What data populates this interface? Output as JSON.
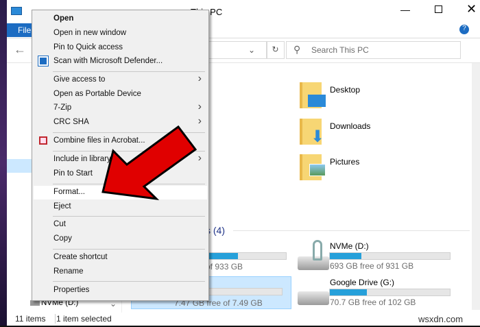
{
  "window": {
    "title": "This PC",
    "file_tab": "File",
    "search_placeholder": "Search This PC"
  },
  "folders": [
    {
      "name": "Desktop"
    },
    {
      "name": "Downloads"
    },
    {
      "name": "Pictures"
    }
  ],
  "devices_header": "s (4)",
  "drives": [
    {
      "name": "",
      "detail": "of 933 GB",
      "used": 0.4
    },
    {
      "name": ":)",
      "detail": "7.47 GB free of 7.49 GB",
      "used": 0.01
    },
    {
      "name": "NVMe (D:)",
      "detail": "693 GB free of 931 GB",
      "used": 0.26
    },
    {
      "name": "Google Drive (G:)",
      "detail": "70.7 GB free of 102 GB",
      "used": 0.31
    }
  ],
  "nav": {
    "last_item": "NVMe (D:)"
  },
  "status": {
    "items": "11 items",
    "selected": "1 item selected"
  },
  "menu": [
    {
      "label": "Open",
      "bold": true
    },
    {
      "label": "Open in new window"
    },
    {
      "label": "Pin to Quick access"
    },
    {
      "label": "Scan with Microsoft Defender..."
    },
    {
      "label": "Give access to",
      "sub": true
    },
    {
      "label": "Open as Portable Device"
    },
    {
      "label": "7-Zip",
      "sub": true
    },
    {
      "label": "CRC SHA",
      "sub": true
    },
    {
      "label": "Combine files in Acrobat..."
    },
    {
      "label": "Include in library",
      "sub": true
    },
    {
      "label": "Pin to Start"
    },
    {
      "label": "Format..."
    },
    {
      "label": "Eject"
    },
    {
      "label": "Cut"
    },
    {
      "label": "Copy"
    },
    {
      "label": "Create shortcut"
    },
    {
      "label": "Rename"
    },
    {
      "label": "Properties"
    }
  ],
  "watermark": "wsxdn.com",
  "colors": {
    "accent": "#26a0da",
    "file_tab": "#1c6cc2",
    "arrow": "#e00000"
  }
}
